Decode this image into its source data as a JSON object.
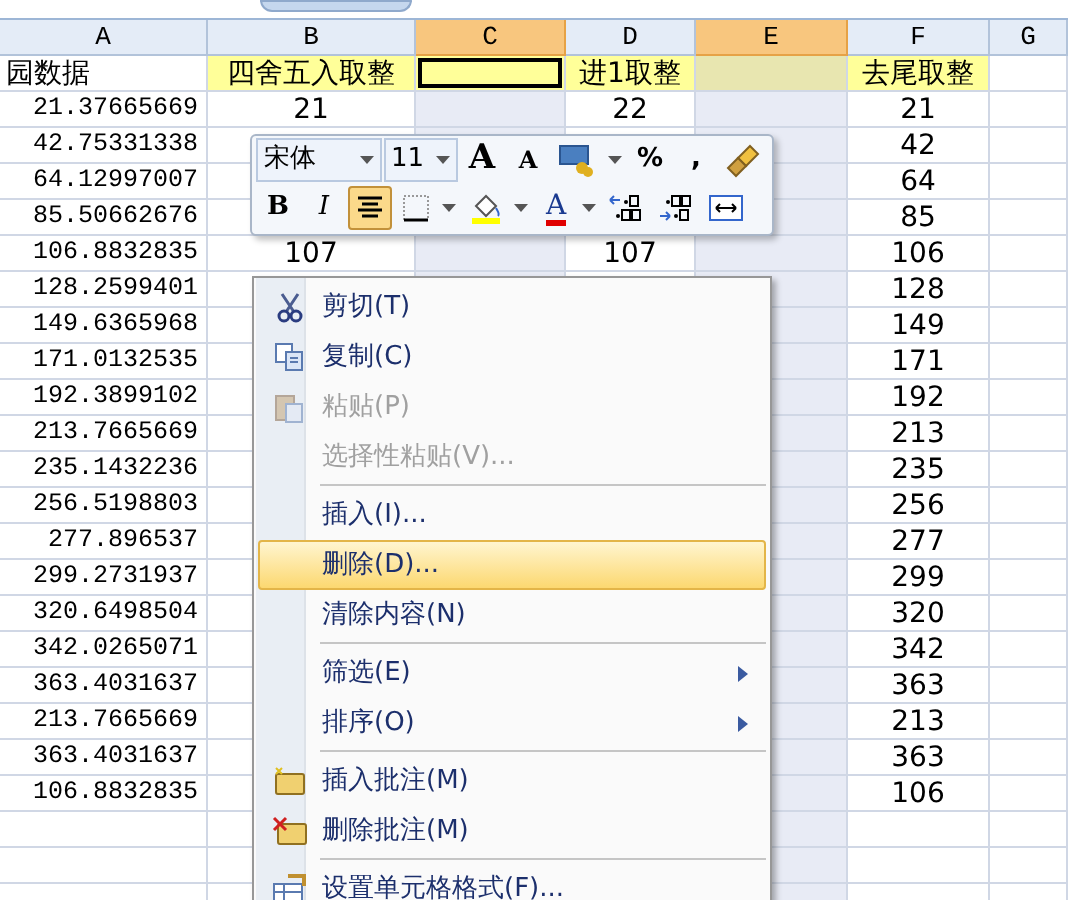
{
  "columns": [
    {
      "label": "A",
      "selected": false,
      "active": false
    },
    {
      "label": "B",
      "selected": false,
      "active": false
    },
    {
      "label": "C",
      "selected": true,
      "active": true
    },
    {
      "label": "D",
      "selected": false,
      "active": false
    },
    {
      "label": "E",
      "selected": true,
      "active": false
    },
    {
      "label": "F",
      "selected": false,
      "active": false
    },
    {
      "label": "G",
      "selected": false,
      "active": false
    }
  ],
  "header_cells": [
    {
      "text": "园数据",
      "highlighted": false
    },
    {
      "text": "四舍五入取整",
      "highlighted": true
    },
    {
      "highlighted": true
    },
    {
      "text": "进1取整",
      "highlighted": true
    },
    {
      "highlighted": true
    },
    {
      "text": "去尾取整",
      "highlighted": true
    },
    {
      "highlighted": false
    }
  ],
  "rows": [
    {
      "a": "21.37665669",
      "b": "21",
      "d": "22",
      "f": "21"
    },
    {
      "a": "42.75331338",
      "f": "42"
    },
    {
      "a": "64.12997007",
      "f": "64"
    },
    {
      "a": "85.50662676",
      "f": "85"
    },
    {
      "a": "106.8832835",
      "b": "107",
      "d": "107",
      "f": "106"
    },
    {
      "a": "128.2599401",
      "f": "128"
    },
    {
      "a": "149.6365968",
      "f": "149"
    },
    {
      "a": "171.0132535",
      "f": "171"
    },
    {
      "a": "192.3899102",
      "f": "192"
    },
    {
      "a": "213.7665669",
      "f": "213"
    },
    {
      "a": "235.1432236",
      "f": "235"
    },
    {
      "a": "256.5198803",
      "f": "256"
    },
    {
      "a": "277.896537",
      "f": "277"
    },
    {
      "a": "299.2731937",
      "f": "299"
    },
    {
      "a": "320.6498504",
      "f": "320"
    },
    {
      "a": "342.0265071",
      "f": "342"
    },
    {
      "a": "363.4031637",
      "f": "363"
    },
    {
      "a": "213.7665669",
      "f": "213"
    },
    {
      "a": "363.4031637",
      "f": "363"
    },
    {
      "a": "106.8832835",
      "f": "106"
    }
  ],
  "mini_toolbar": {
    "rows": [
      [
        {
          "kind": "font",
          "value": "宋体"
        },
        {
          "kind": "size",
          "value": "11"
        },
        {
          "kind": "grow",
          "label": "A",
          "selected": false
        },
        {
          "kind": "shrink",
          "label": "A",
          "selected": false
        },
        {
          "kind": "currency",
          "selected": false
        },
        {
          "kind": "text",
          "label": "%",
          "selected": false
        },
        {
          "kind": "text",
          "label": ",",
          "selected": false
        },
        {
          "kind": "brush",
          "selected": false
        }
      ],
      [
        {
          "kind": "bold",
          "label": "B",
          "selected": false
        },
        {
          "kind": "italic",
          "label": "I",
          "selected": false
        },
        {
          "kind": "center",
          "selected": true
        },
        {
          "kind": "borders",
          "selected": false
        },
        {
          "kind": "fill",
          "selected": false
        },
        {
          "kind": "fontcolor",
          "label": "A",
          "selected": false
        },
        {
          "kind": "incdec",
          "selected": false
        },
        {
          "kind": "decdec",
          "selected": false
        },
        {
          "kind": "merge",
          "selected": false
        }
      ]
    ]
  },
  "context_menu": [
    {
      "kind": "cut",
      "label": "剪切(T)",
      "disabled": false,
      "selected": false,
      "submenu": false
    },
    {
      "kind": "copy",
      "label": "复制(C)",
      "disabled": false,
      "selected": false,
      "submenu": false
    },
    {
      "kind": "paste",
      "label": "粘贴(P)",
      "disabled": true,
      "selected": false,
      "submenu": false
    },
    {
      "kind": "item",
      "label": "选择性粘贴(V)...",
      "disabled": true,
      "selected": false,
      "submenu": false
    },
    {
      "kind": "separator"
    },
    {
      "kind": "item",
      "label": "插入(I)...",
      "disabled": false,
      "selected": false,
      "submenu": false
    },
    {
      "kind": "item",
      "label": "删除(D)...",
      "disabled": false,
      "selected": true,
      "submenu": false
    },
    {
      "kind": "item",
      "label": "清除内容(N)",
      "disabled": false,
      "selected": false,
      "submenu": false
    },
    {
      "kind": "separator"
    },
    {
      "kind": "item",
      "label": "筛选(E)",
      "disabled": false,
      "selected": false,
      "submenu": true
    },
    {
      "kind": "item",
      "label": "排序(O)",
      "disabled": false,
      "selected": false,
      "submenu": true
    },
    {
      "kind": "separator"
    },
    {
      "kind": "note-add",
      "label": "插入批注(M)",
      "disabled": false,
      "selected": false,
      "submenu": false
    },
    {
      "kind": "note-delete",
      "label": "删除批注(M)",
      "disabled": false,
      "selected": false,
      "submenu": false
    },
    {
      "kind": "separator"
    },
    {
      "kind": "format",
      "label": "设置单元格格式(F)...",
      "disabled": false,
      "selected": false,
      "submenu": false
    }
  ]
}
